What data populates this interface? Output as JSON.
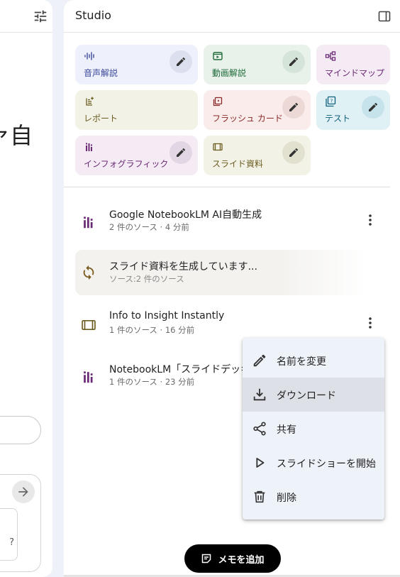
{
  "left_panel": {
    "partial_heading": "ァ自",
    "partial_text": "?"
  },
  "studio": {
    "title": "Studio",
    "tiles": [
      {
        "label": "音声解説",
        "icon": "audio-waveform-icon",
        "color": "#3b4a9b",
        "bg": "#eef0fb"
      },
      {
        "label": "動画解説",
        "icon": "video-play-icon",
        "color": "#1e6b3a",
        "bg": "#e8f2ea"
      },
      {
        "label": "マインドマップ",
        "icon": "mind-map-icon",
        "color": "#6b2a75",
        "bg": "#f4ebf4"
      },
      {
        "label": "レポート",
        "icon": "report-icon",
        "color": "#6b5d21",
        "bg": "#f3f2e6"
      },
      {
        "label": "フラッシュ カード",
        "icon": "flashcard-icon",
        "color": "#8b2a2a",
        "bg": "#f9ecea"
      },
      {
        "label": "テスト",
        "icon": "quiz-icon",
        "color": "#0e5f7a",
        "bg": "#e0f1f6"
      },
      {
        "label": "インフォグラフィック",
        "icon": "infographic-icon",
        "color": "#6b2a75",
        "bg": "#f4ebf4"
      },
      {
        "label": "スライド資料",
        "icon": "slides-icon",
        "color": "#6b5d21",
        "bg": "#f3f2e6"
      }
    ],
    "notes": [
      {
        "title": "Google NotebookLM AI自動生成",
        "subtitle": "2 件のソース · 4 分前",
        "icon": "infographic-icon"
      },
      {
        "title": "スライド資料を生成しています...",
        "subtitle": "ソース:2 件のソース",
        "icon": "sync-icon"
      },
      {
        "title": "Info to Insight Instantly",
        "subtitle": "1 件のソース · 16 分前",
        "icon": "slides-icon"
      },
      {
        "title": "NotebookLM「スライドデッキ",
        "subtitle": "1 件のソース · 23 分前",
        "icon": "infographic-icon"
      }
    ],
    "add_note_label": "メモを追加"
  },
  "context_menu": {
    "items": [
      {
        "label": "名前を変更",
        "icon": "pencil-icon"
      },
      {
        "label": "ダウンロード",
        "icon": "download-icon"
      },
      {
        "label": "共有",
        "icon": "share-icon"
      },
      {
        "label": "スライドショーを開始",
        "icon": "play-icon"
      },
      {
        "label": "削除",
        "icon": "trash-icon"
      }
    ],
    "hovered_index": 1
  },
  "colors": {
    "background": "#eef1f8",
    "panel": "#ffffff",
    "menu_bg": "#eef2f9",
    "menu_hover": "#dde0e6",
    "infographic_purple": "#6b2a75",
    "slides_olive": "#6b5d21",
    "sync_brown": "#7a5b1e"
  }
}
